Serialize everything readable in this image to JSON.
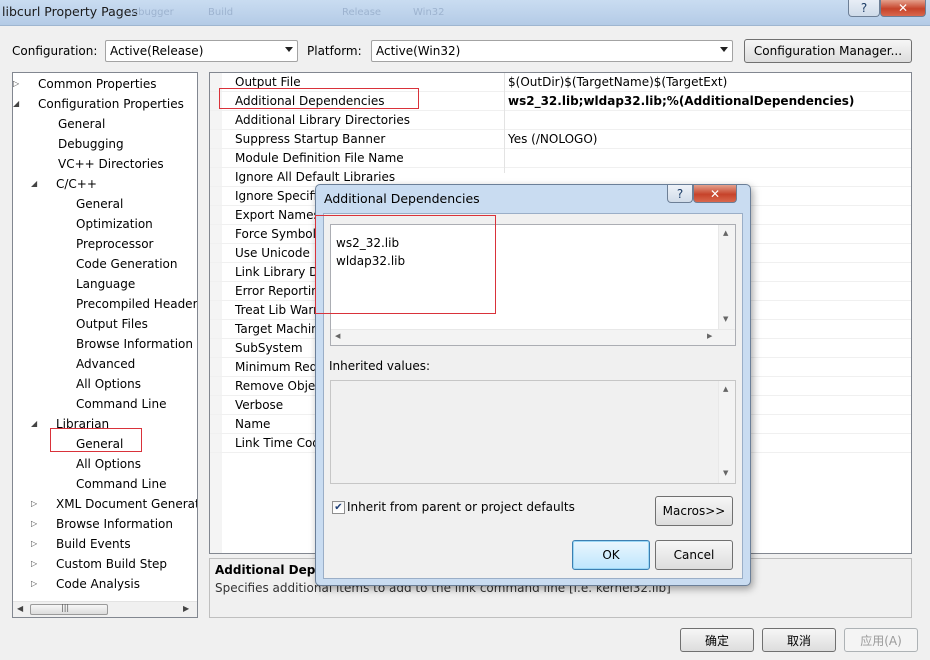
{
  "window": {
    "title": "libcurl Property Pages",
    "ghost_tabs": [
      "ebugger",
      "Build",
      "Release",
      "Win32"
    ],
    "help_button": "?",
    "close_button": "✕"
  },
  "toolbar": {
    "configuration_label": "Configuration:",
    "configuration_value": "Active(Release)",
    "platform_label": "Platform:",
    "platform_value": "Active(Win32)",
    "config_manager_button": "Configuration Manager..."
  },
  "tree": {
    "items": [
      {
        "label": "Common Properties",
        "arrow": "▷"
      },
      {
        "label": "Configuration Properties",
        "arrow": "◢"
      },
      {
        "label": "General",
        "arrow": ""
      },
      {
        "label": "Debugging",
        "arrow": ""
      },
      {
        "label": "VC++ Directories",
        "arrow": ""
      },
      {
        "label": "C/C++",
        "arrow": "◢"
      },
      {
        "label": "General",
        "arrow": ""
      },
      {
        "label": "Optimization",
        "arrow": ""
      },
      {
        "label": "Preprocessor",
        "arrow": ""
      },
      {
        "label": "Code Generation",
        "arrow": ""
      },
      {
        "label": "Language",
        "arrow": ""
      },
      {
        "label": "Precompiled Header",
        "arrow": ""
      },
      {
        "label": "Output Files",
        "arrow": ""
      },
      {
        "label": "Browse Information",
        "arrow": ""
      },
      {
        "label": "Advanced",
        "arrow": ""
      },
      {
        "label": "All Options",
        "arrow": ""
      },
      {
        "label": "Command Line",
        "arrow": ""
      },
      {
        "label": "Librarian",
        "arrow": "◢"
      },
      {
        "label": "General",
        "arrow": ""
      },
      {
        "label": "All Options",
        "arrow": ""
      },
      {
        "label": "Command Line",
        "arrow": ""
      },
      {
        "label": "XML Document Generat",
        "arrow": "▷"
      },
      {
        "label": "Browse Information",
        "arrow": "▷"
      },
      {
        "label": "Build Events",
        "arrow": "▷"
      },
      {
        "label": "Custom Build Step",
        "arrow": "▷"
      },
      {
        "label": "Code Analysis",
        "arrow": "▷"
      }
    ],
    "scroll_left": "◀",
    "scroll_right": "▶",
    "scroll_grip": "|||"
  },
  "grid": {
    "rows": [
      {
        "name": "Output File",
        "value": "$(OutDir)$(TargetName)$(TargetExt)",
        "bold": false
      },
      {
        "name": "Additional Dependencies",
        "value": "ws2_32.lib;wldap32.lib;%(AdditionalDependencies)",
        "bold": true
      },
      {
        "name": "Additional Library Directories",
        "value": "",
        "bold": false
      },
      {
        "name": "Suppress Startup Banner",
        "value": "Yes (/NOLOGO)",
        "bold": false
      },
      {
        "name": "Module Definition File Name",
        "value": "",
        "bold": false
      },
      {
        "name": "Ignore All Default Libraries",
        "value": "",
        "bold": false
      },
      {
        "name": "Ignore Specific",
        "value": "",
        "bold": false
      },
      {
        "name": "Export Names",
        "value": "",
        "bold": false
      },
      {
        "name": "Force Symbol",
        "value": "",
        "bold": false
      },
      {
        "name": "Use Unicode",
        "value": "",
        "bold": false
      },
      {
        "name": "Link Library D",
        "value": "",
        "bold": false
      },
      {
        "name": "Error Reporting",
        "value": "",
        "bold": false
      },
      {
        "name": "Treat Lib Warr",
        "value": "",
        "bold": false
      },
      {
        "name": "Target Machine",
        "value": "",
        "bold": false
      },
      {
        "name": "SubSystem",
        "value": "",
        "bold": false
      },
      {
        "name": "Minimum Requ",
        "value": "",
        "bold": false
      },
      {
        "name": "Remove Objec",
        "value": "",
        "bold": false
      },
      {
        "name": "Verbose",
        "value": "",
        "bold": false
      },
      {
        "name": "Name",
        "value": "",
        "bold": false
      },
      {
        "name": "Link Time Cod",
        "value": "",
        "bold": false
      }
    ]
  },
  "description": {
    "title": "Additional Depe",
    "text": "Specifies additional items to add to the link command line [i.e. kernel32.lib]"
  },
  "footer": {
    "ok": "确定",
    "cancel": "取消",
    "apply": "应用(A)"
  },
  "dialog": {
    "title": "Additional Dependencies",
    "help_button": "?",
    "close_button": "✕",
    "lines": [
      "ws2_32.lib",
      "wldap32.lib"
    ],
    "inherited_label": "Inherited values:",
    "inherit_checkbox_label": "Inherit from parent or project defaults",
    "inherit_checked": true,
    "macros_button": "Macros>>",
    "ok_button": "OK",
    "cancel_button": "Cancel"
  },
  "colors": {
    "highlight_box": "#d9323a",
    "title_bar": "#c9dcf1"
  }
}
